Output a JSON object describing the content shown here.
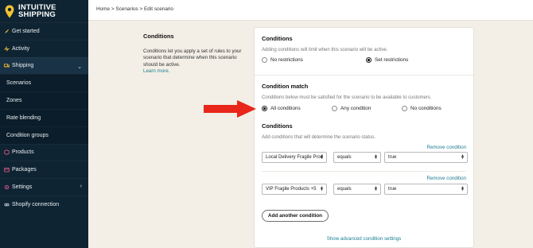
{
  "brand": {
    "line1": "INTUITIVE",
    "line2": "SHIPPING"
  },
  "colors": {
    "sidebar": "#0f2433",
    "accent": "#1c7e93",
    "arrow": "#e8261a",
    "logo_pin": "#f3c232"
  },
  "sidebar": {
    "items": [
      {
        "label": "Get started",
        "icon": "rocket-icon"
      },
      {
        "label": "Activity",
        "icon": "pulse-icon"
      },
      {
        "label": "Shipping",
        "icon": "truck-icon",
        "expanded": true
      },
      {
        "label": "Scenarios"
      },
      {
        "label": "Zones"
      },
      {
        "label": "Rate blending"
      },
      {
        "label": "Condition groups"
      },
      {
        "label": "Products",
        "icon": "box-icon"
      },
      {
        "label": "Packages",
        "icon": "package-icon"
      },
      {
        "label": "Settings",
        "icon": "gear-icon"
      },
      {
        "label": "Shopify connection",
        "icon": "link-icon"
      }
    ]
  },
  "breadcrumb": "Home > Scenarios > Edit scenario",
  "left_panel": {
    "title": "Conditions",
    "description": "Conditions let you apply a set of rules to your scenario that determine when this scenario should be active.",
    "learn_more": "Learn more."
  },
  "conditions": {
    "title": "Conditions",
    "hint": "Adding conditions will limit when this scenario will be active.",
    "options": [
      {
        "label": "No restrictions",
        "selected": false
      },
      {
        "label": "Set restrictions",
        "selected": true
      }
    ]
  },
  "condition_match": {
    "title": "Condition match",
    "hint": "Conditions below must be satisfied for the scenario to be available to customers.",
    "options": [
      {
        "label": "All conditions",
        "selected": true
      },
      {
        "label": "Any condition",
        "selected": false
      },
      {
        "label": "No conditions",
        "selected": false
      }
    ]
  },
  "condition_list": {
    "title": "Conditions",
    "hint": "Add conditions that will determine the scenario status.",
    "remove_label": "Remove condition",
    "rows": [
      {
        "field": "Local Delivery Fragile Prod",
        "operator": "equals",
        "value": "true"
      },
      {
        "field": "VIP Fragile Products +5",
        "operator": "equals",
        "value": "true"
      }
    ],
    "add_label": "Add another condition",
    "advanced_link": "Show advanced condition settings"
  }
}
